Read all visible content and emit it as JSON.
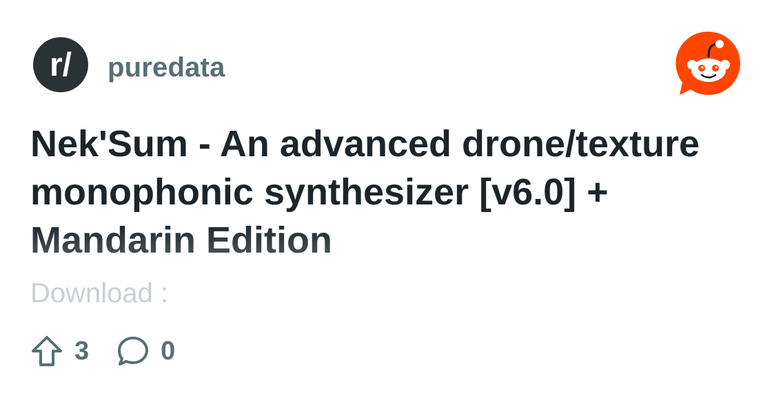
{
  "subreddit": {
    "name": "puredata",
    "avatar_text": "r/",
    "avatar_color": "#2a3236"
  },
  "brand": {
    "logo_icon": "reddit-snoo-icon",
    "accent_color": "#ff4500"
  },
  "post": {
    "title": "Nek'Sum - An advanced drone/texture monophonic synthesizer [v6.0] + Mandarin Edition",
    "body_preview": "Download :"
  },
  "stats": {
    "upvotes": "3",
    "comments": "0",
    "upvote_icon": "upvote-arrow-icon",
    "comment_icon": "comment-bubble-icon"
  }
}
